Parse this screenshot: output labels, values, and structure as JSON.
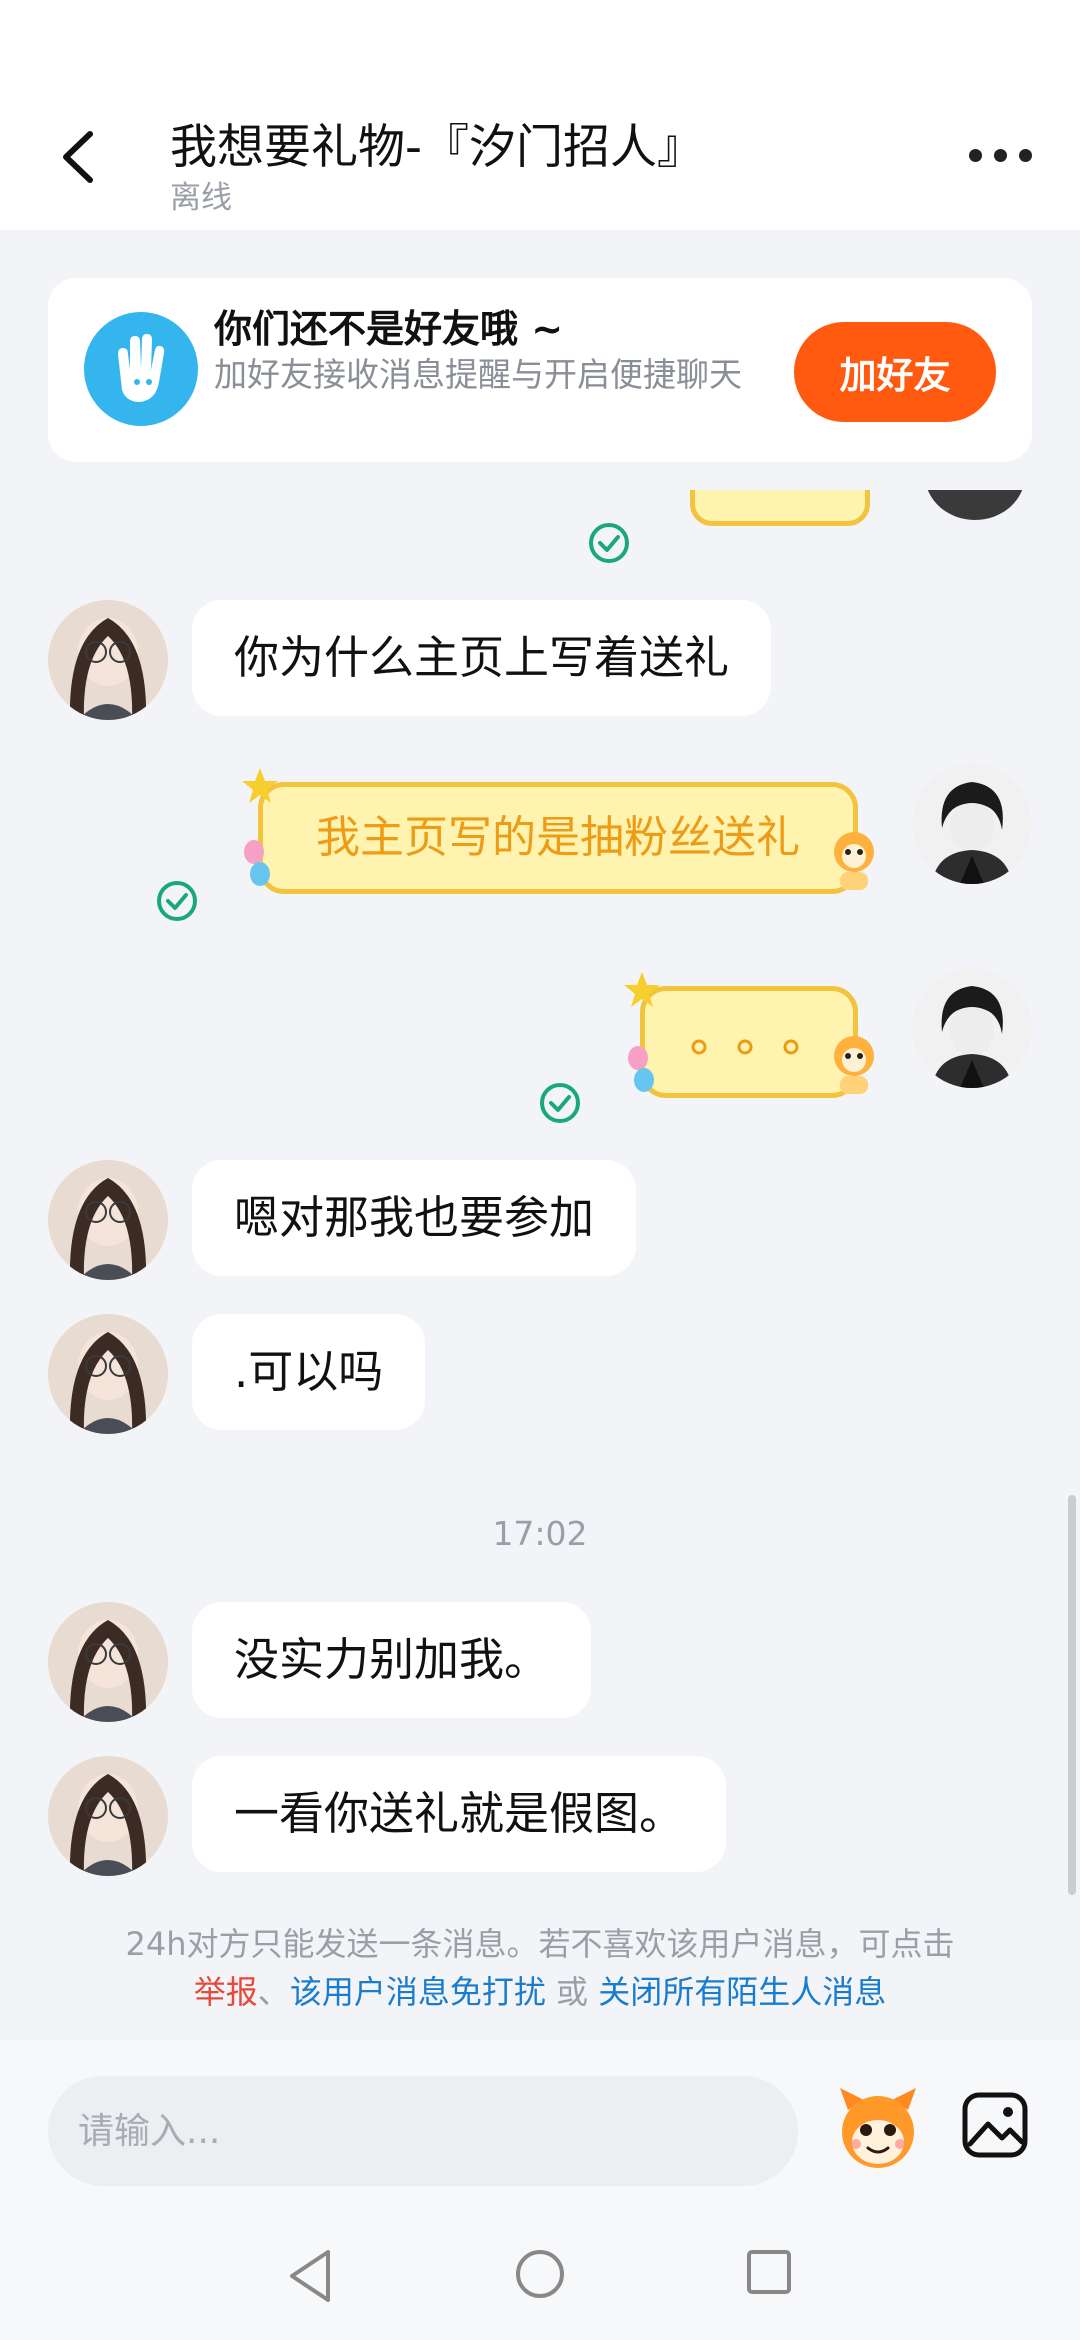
{
  "header": {
    "title": "我想要礼物-『汐门招人』",
    "status": "离线"
  },
  "friend_card": {
    "title": "你们还不是好友哦 ~",
    "description": "加好友接收消息提醒与开启便捷聊天",
    "button": "加好友"
  },
  "messages": [
    {
      "side": "left",
      "text": "你为什么主页上写着送礼"
    },
    {
      "side": "right",
      "text": "我主页写的是抽粉丝送礼"
    },
    {
      "side": "right",
      "text": "。。。"
    },
    {
      "side": "left",
      "text": "嗯对那我也要参加"
    },
    {
      "side": "left",
      "text": ".可以吗"
    },
    {
      "side": "left",
      "text": "没实力别加我。"
    },
    {
      "side": "left",
      "text": "一看你送礼就是假图。"
    }
  ],
  "time_separator": "17:02",
  "notice": {
    "text": "24h对方只能发送一条消息。若不喜欢该用户消息，可点击",
    "report": "举报",
    "sep1": "、",
    "mute": "该用户消息免打扰",
    "or": " 或 ",
    "close_all": "关闭所有陌生人消息"
  },
  "input": {
    "placeholder": "请输入..."
  },
  "colors": {
    "accent": "#ff5a10",
    "link_blue": "#1a7ccc",
    "link_red": "#e54a3a",
    "check_green": "#1aa87a"
  },
  "icons": [
    "back-arrow-icon",
    "more-icon",
    "wave-hand-icon",
    "check-icon",
    "emoji-icon",
    "image-icon",
    "nav-back-icon",
    "nav-home-icon",
    "nav-recent-icon"
  ]
}
